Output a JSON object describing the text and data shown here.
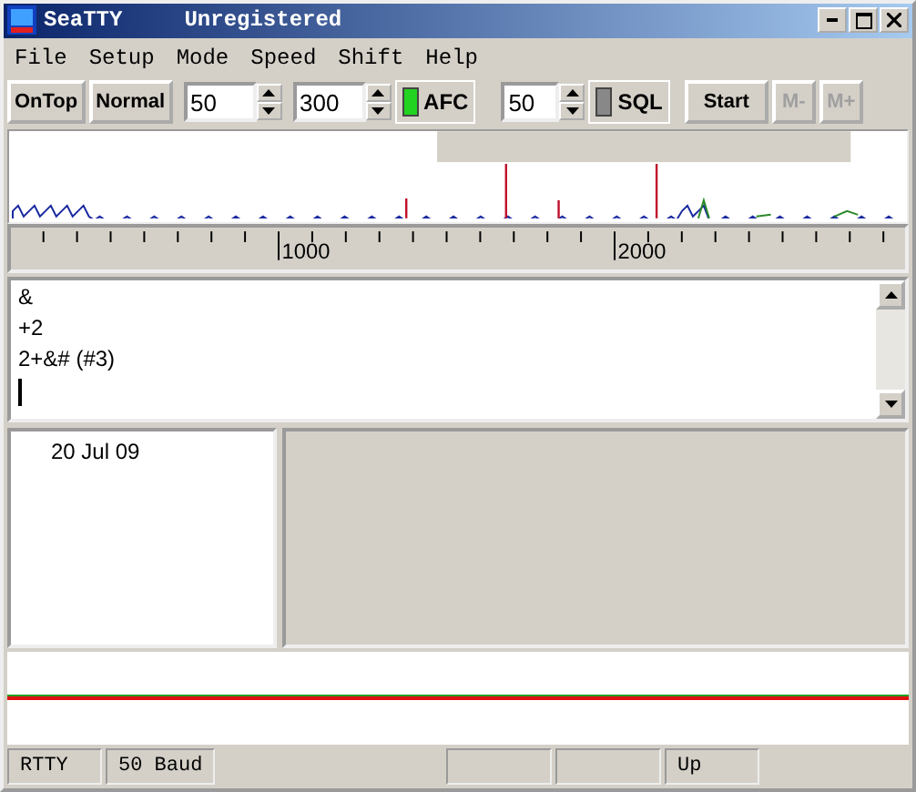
{
  "window": {
    "title": "SeaTTY",
    "subtitle": "Unregistered"
  },
  "menu": [
    "File",
    "Setup",
    "Mode",
    "Speed",
    "Shift",
    "Help"
  ],
  "toolbar": [
    {
      "kind": "button",
      "label": "OnTop",
      "disabled": false
    },
    {
      "kind": "button",
      "label": "Normal",
      "disabled": false
    },
    {
      "kind": "spin",
      "value": "50"
    },
    {
      "kind": "spin",
      "value": "300"
    },
    {
      "kind": "indicator",
      "label": "AFC",
      "on": true
    },
    {
      "kind": "spin",
      "value": "50"
    },
    {
      "kind": "indicator",
      "label": "SQL",
      "on": false
    },
    {
      "kind": "button",
      "label": "Start",
      "disabled": false
    },
    {
      "kind": "button",
      "label": "M-",
      "disabled": true
    },
    {
      "kind": "button",
      "label": "M+",
      "disabled": true
    }
  ],
  "ruler": {
    "labels": [
      "1000",
      "2000"
    ]
  },
  "receive_text": [
    "&",
    "+2",
    "2+&# (#3)"
  ],
  "log": {
    "date": "20 Jul 09"
  },
  "status_bar": [
    {
      "kind": "text",
      "text": "RTTY"
    },
    {
      "kind": "text",
      "text": "50 Baud"
    },
    {
      "kind": "blank"
    },
    {
      "kind": "blank"
    },
    {
      "kind": "text",
      "text": "Up"
    }
  ]
}
